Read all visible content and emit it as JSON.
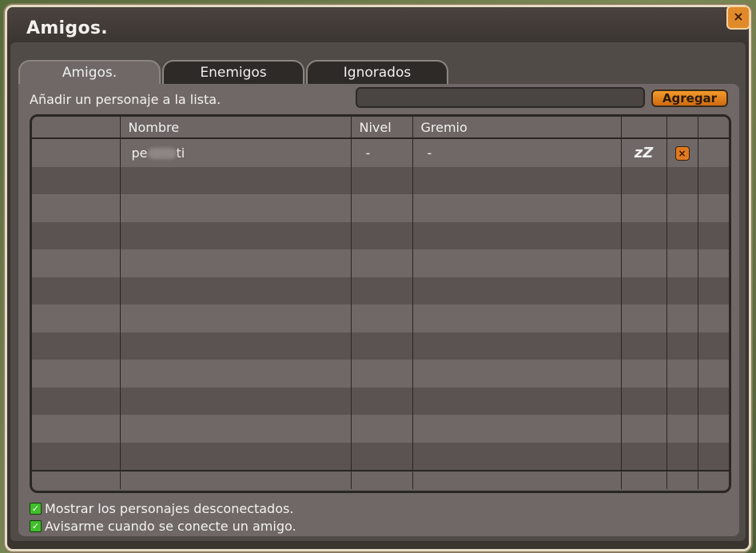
{
  "window": {
    "title": "Amigos.",
    "close_label": "×"
  },
  "tabs": [
    {
      "label": "Amigos.",
      "active": true
    },
    {
      "label": "Enemigos",
      "active": false
    },
    {
      "label": "Ignorados",
      "active": false
    }
  ],
  "add": {
    "label": "Añadir un personaje a la lista.",
    "input_value": "",
    "button_label": "Agregar"
  },
  "table": {
    "columns": [
      "",
      "Nombre",
      "Nivel",
      "Gremio",
      "",
      "",
      ""
    ],
    "rows": [
      {
        "name_prefix": "pe",
        "name_suffix": "ti",
        "level": "-",
        "guild": "-",
        "status_icon": "zZ",
        "remove_label": "×"
      }
    ]
  },
  "options": [
    {
      "label": "Mostrar los personajes desconectados.",
      "checked": true
    },
    {
      "label": "Avisarme cuando se conecte un amigo.",
      "checked": true
    }
  ]
}
